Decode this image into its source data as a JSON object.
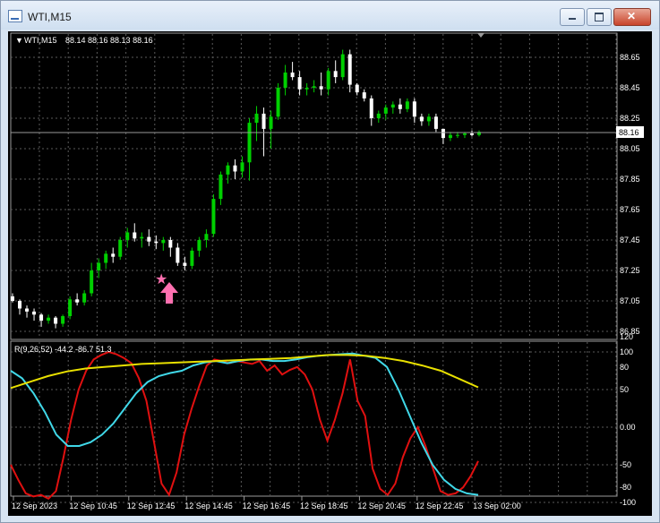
{
  "window": {
    "title": "WTI,M15"
  },
  "main_header": {
    "symbol_tf": "WTI,M15",
    "ohlc": "88.14 88.16 88.13 88.16"
  },
  "price_scale": {
    "labels": [
      "88.65",
      "88.45",
      "88.25",
      "88.05",
      "87.85",
      "87.65",
      "87.45",
      "87.25",
      "87.05",
      "86.85"
    ],
    "current": "88.16"
  },
  "indicator": {
    "header": "R(9,26,52) -44.2 -86.7 51.3",
    "scale_labels": [
      "120",
      "100",
      "80",
      "50",
      "0.00",
      "-50",
      "-80",
      "-100"
    ]
  },
  "time_axis": {
    "labels": [
      "12 Sep 2023",
      "12 Sep 10:45",
      "12 Sep 12:45",
      "12 Sep 14:45",
      "12 Sep 16:45",
      "12 Sep 18:45",
      "12 Sep 20:45",
      "12 Sep 22:45",
      "13 Sep 02:00"
    ]
  },
  "annotations": {
    "signal": "star",
    "arrow": "up-arrow"
  },
  "colors": {
    "bg": "#000000",
    "grid": "#5a5a5a",
    "bull": "#00d000",
    "bear": "#ffffff",
    "red_line": "#e01010",
    "cyan_line": "#40d8e8",
    "yellow_line": "#e8e000",
    "signal": "#ff70b0"
  },
  "chart_data": [
    {
      "type": "candlestick",
      "title": "WTI,M15",
      "ylim": [
        86.82,
        88.76
      ],
      "candles": [
        [
          87.08,
          87.1,
          87.04,
          87.05
        ],
        [
          87.05,
          87.06,
          86.96,
          87.0
        ],
        [
          87.0,
          87.02,
          86.94,
          86.98
        ],
        [
          86.98,
          87.0,
          86.92,
          86.96
        ],
        [
          86.96,
          86.97,
          86.88,
          86.92
        ],
        [
          86.92,
          86.96,
          86.9,
          86.94
        ],
        [
          86.94,
          86.95,
          86.87,
          86.9
        ],
        [
          86.9,
          86.96,
          86.88,
          86.95
        ],
        [
          86.95,
          87.08,
          86.93,
          87.06
        ],
        [
          87.06,
          87.1,
          87.02,
          87.04
        ],
        [
          87.04,
          87.12,
          87.02,
          87.1
        ],
        [
          87.1,
          87.3,
          87.08,
          87.25
        ],
        [
          87.25,
          87.33,
          87.2,
          87.3
        ],
        [
          87.3,
          87.38,
          87.26,
          87.36
        ],
        [
          87.36,
          87.4,
          87.3,
          87.34
        ],
        [
          87.34,
          87.47,
          87.32,
          87.45
        ],
        [
          87.45,
          87.53,
          87.4,
          87.5
        ],
        [
          87.5,
          87.56,
          87.44,
          87.46
        ],
        [
          87.46,
          87.5,
          87.4,
          87.47
        ],
        [
          87.47,
          87.52,
          87.41,
          87.44
        ],
        [
          87.44,
          87.48,
          87.39,
          87.43
        ],
        [
          87.43,
          87.47,
          87.38,
          87.45
        ],
        [
          87.45,
          87.47,
          87.34,
          87.4
        ],
        [
          87.4,
          87.43,
          87.28,
          87.3
        ],
        [
          87.3,
          87.34,
          87.25,
          87.28
        ],
        [
          87.28,
          87.4,
          87.26,
          87.38
        ],
        [
          87.38,
          87.47,
          87.34,
          87.45
        ],
        [
          87.45,
          87.52,
          87.4,
          87.49
        ],
        [
          87.49,
          87.75,
          87.47,
          87.72
        ],
        [
          87.72,
          87.9,
          87.68,
          87.88
        ],
        [
          87.88,
          87.96,
          87.82,
          87.94
        ],
        [
          87.94,
          87.98,
          87.85,
          87.9
        ],
        [
          87.9,
          88.0,
          87.86,
          87.96
        ],
        [
          87.96,
          88.25,
          87.84,
          88.22
        ],
        [
          88.22,
          88.33,
          88.1,
          88.28
        ],
        [
          88.28,
          88.32,
          88.0,
          88.18
        ],
        [
          88.18,
          88.3,
          88.05,
          88.26
        ],
        [
          88.26,
          88.48,
          88.24,
          88.45
        ],
        [
          88.45,
          88.6,
          88.4,
          88.55
        ],
        [
          88.55,
          88.62,
          88.5,
          88.52
        ],
        [
          88.52,
          88.56,
          88.4,
          88.44
        ],
        [
          88.44,
          88.48,
          88.4,
          88.45
        ],
        [
          88.45,
          88.5,
          88.42,
          88.46
        ],
        [
          88.46,
          88.55,
          88.4,
          88.44
        ],
        [
          88.44,
          88.58,
          88.4,
          88.56
        ],
        [
          88.56,
          88.63,
          88.48,
          88.52
        ],
        [
          88.52,
          88.7,
          88.5,
          88.67
        ],
        [
          88.67,
          88.7,
          88.42,
          88.47
        ],
        [
          88.47,
          88.48,
          88.4,
          88.42
        ],
        [
          88.42,
          88.44,
          88.36,
          88.38
        ],
        [
          88.38,
          88.4,
          88.2,
          88.25
        ],
        [
          88.25,
          88.3,
          88.22,
          88.28
        ],
        [
          88.28,
          88.34,
          88.24,
          88.32
        ],
        [
          88.32,
          88.36,
          88.28,
          88.34
        ],
        [
          88.34,
          88.38,
          88.28,
          88.31
        ],
        [
          88.31,
          88.38,
          88.29,
          88.36
        ],
        [
          88.36,
          88.38,
          88.22,
          88.26
        ],
        [
          88.26,
          88.28,
          88.2,
          88.23
        ],
        [
          88.23,
          88.28,
          88.2,
          88.26
        ],
        [
          88.26,
          88.28,
          88.16,
          88.18
        ],
        [
          88.18,
          88.18,
          88.08,
          88.12
        ],
        [
          88.12,
          88.16,
          88.1,
          88.14
        ],
        [
          88.14,
          88.16,
          88.12,
          88.14
        ],
        [
          88.14,
          88.16,
          88.12,
          88.15
        ],
        [
          88.15,
          88.17,
          88.13,
          88.14
        ],
        [
          88.14,
          88.17,
          88.13,
          88.16
        ]
      ]
    },
    {
      "type": "line",
      "ylim": [
        -104,
        124
      ],
      "series": [
        {
          "color": "#e01010",
          "values": [
            -50,
            -70,
            -88,
            -92,
            -90,
            -95,
            -85,
            -40,
            10,
            50,
            75,
            90,
            96,
            100,
            97,
            92,
            85,
            65,
            35,
            -20,
            -75,
            -90,
            -60,
            -10,
            25,
            55,
            82,
            90,
            88,
            85,
            88,
            86,
            84,
            88,
            75,
            82,
            70,
            76,
            80,
            70,
            50,
            10,
            -18,
            10,
            45,
            90,
            35,
            15,
            -55,
            -82,
            -90,
            -75,
            -40,
            -15,
            0,
            -25,
            -55,
            -85,
            -90,
            -88,
            -80,
            -65,
            -45
          ]
        },
        {
          "color": "#40d8e8",
          "values": [
            75,
            65,
            45,
            20,
            -10,
            -25,
            -25,
            -20,
            -10,
            5,
            25,
            45,
            60,
            68,
            72,
            75,
            82,
            86,
            88,
            85,
            88,
            90,
            90,
            88,
            88,
            90,
            93,
            95,
            96,
            97,
            98,
            95,
            92,
            80,
            50,
            15,
            -20,
            -50,
            -70,
            -82,
            -88,
            -90
          ]
        },
        {
          "color": "#e8e000",
          "values": [
            52,
            60,
            68,
            74,
            78,
            80,
            82,
            84,
            85,
            86,
            87,
            88,
            89,
            90,
            91,
            92,
            94,
            96,
            96,
            95,
            92,
            88,
            82,
            75,
            64,
            53
          ]
        }
      ]
    }
  ]
}
